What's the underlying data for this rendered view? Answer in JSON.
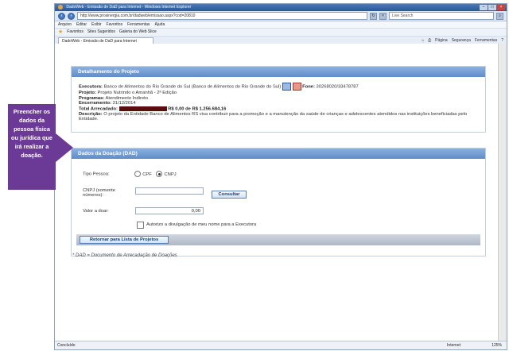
{
  "window": {
    "title": "DadoWeb - Emissão de DaD para Internet - Windows Internet Explorer",
    "url": "http://www.prosinergia.com.br/dadweb/emissao.aspx?cod=20810",
    "search_placeholder": "Live Search",
    "menu": [
      "Arquivo",
      "Editar",
      "Exibir",
      "Favoritos",
      "Ferramentas",
      "Ajuda"
    ],
    "favorites_label": "Favoritos",
    "fav_links": [
      "Sites Sugeridos",
      "Galeria do Web Slice"
    ],
    "tab_title": "DadoWeb - Emissão de DaD para Internet",
    "commands": [
      "Página",
      "Segurança",
      "Ferramentas"
    ],
    "status_left": "Concluído",
    "status_zone": "Internet",
    "zoom": "125%"
  },
  "callout": {
    "text": "Preencher os dados da pessoa física ou jurídica que irá realizar a doação."
  },
  "project": {
    "header": "Detalhamento do Projeto",
    "executora_label": "Executora:",
    "executora_value": "Banco de Alimentos do Rio Grande do Sul (Banco de Alimentos do Rio Grande do Sul)",
    "fone_label": "Fone:",
    "fone_value": "30268020/33478787",
    "projeto_label": "Projeto:",
    "projeto_value": "Projeto Nutrindo o Amanhã - 2ª Edição",
    "programas_label": "Programas:",
    "programas_value": "Atendimento Indireto",
    "encerramento_label": "Encerramento:",
    "encerramento_value": "31/12/2014",
    "total_label": "Total Arrecadado:",
    "total_value": "R$ 0,00 de R$ 1.256.684,16",
    "descricao_label": "Descrição:",
    "descricao_value": "O projeto da Entidade Banco de Alimentos RS visa contribuir para a promoção e a manutenção da saúde de crianças e adolescentes atendidos nas instituições beneficiadas pelo Entidade."
  },
  "donation": {
    "header": "Dados da Doação (DAD)",
    "tipo_label": "Tipo Pessoa:",
    "option_cpf": "CPF",
    "option_cnpj": "CNPJ",
    "selected": "CNPJ",
    "cnpj_label": "CNPJ (somente números):",
    "cnpj_value": "",
    "consultar": "Consultar",
    "valor_label": "Valor a doar:",
    "valor_value": "0,00",
    "autorizo": "Autorizo a divulgação de meu nome para a Executora",
    "retornar": "Retornar para Lista de Projetos"
  },
  "footnote": "* DAD = Documento de Arrecadação de Doações"
}
